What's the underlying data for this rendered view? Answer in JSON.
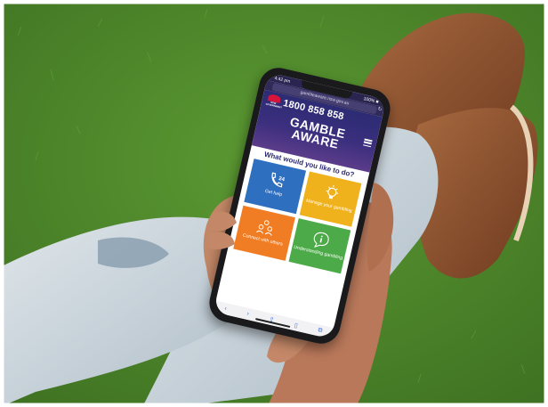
{
  "phone_screen": {
    "status": {
      "time": "4:42 pm",
      "battery": "100% ■"
    },
    "url": "gambleaware.nsw.gov.au",
    "logo": {
      "text": "NSW\nGOVERNMENT"
    },
    "helpline": "1800 858 858",
    "brand_title": "GAMBLE\nAWARE",
    "question": "What would you like to do?",
    "tiles": [
      {
        "label": "Get help",
        "color": "#2e6fc0",
        "icon": "phone-24-icon"
      },
      {
        "label": "Manage your gambling",
        "color": "#f0b21c",
        "icon": "lightbulb-icon"
      },
      {
        "label": "Connect with others",
        "color": "#f07c23",
        "icon": "people-icon"
      },
      {
        "label": "Understanding gambling",
        "color": "#4caa49",
        "icon": "info-bubble-icon"
      }
    ],
    "nav_icons": [
      "back-icon",
      "forward-icon",
      "share-icon",
      "bookmarks-icon",
      "tabs-icon"
    ]
  },
  "scene_colors": {
    "grass": "#4f8a2a",
    "jeans": "#c9d3da",
    "boot": "#8a4f2c",
    "skin": "#b9785a"
  }
}
